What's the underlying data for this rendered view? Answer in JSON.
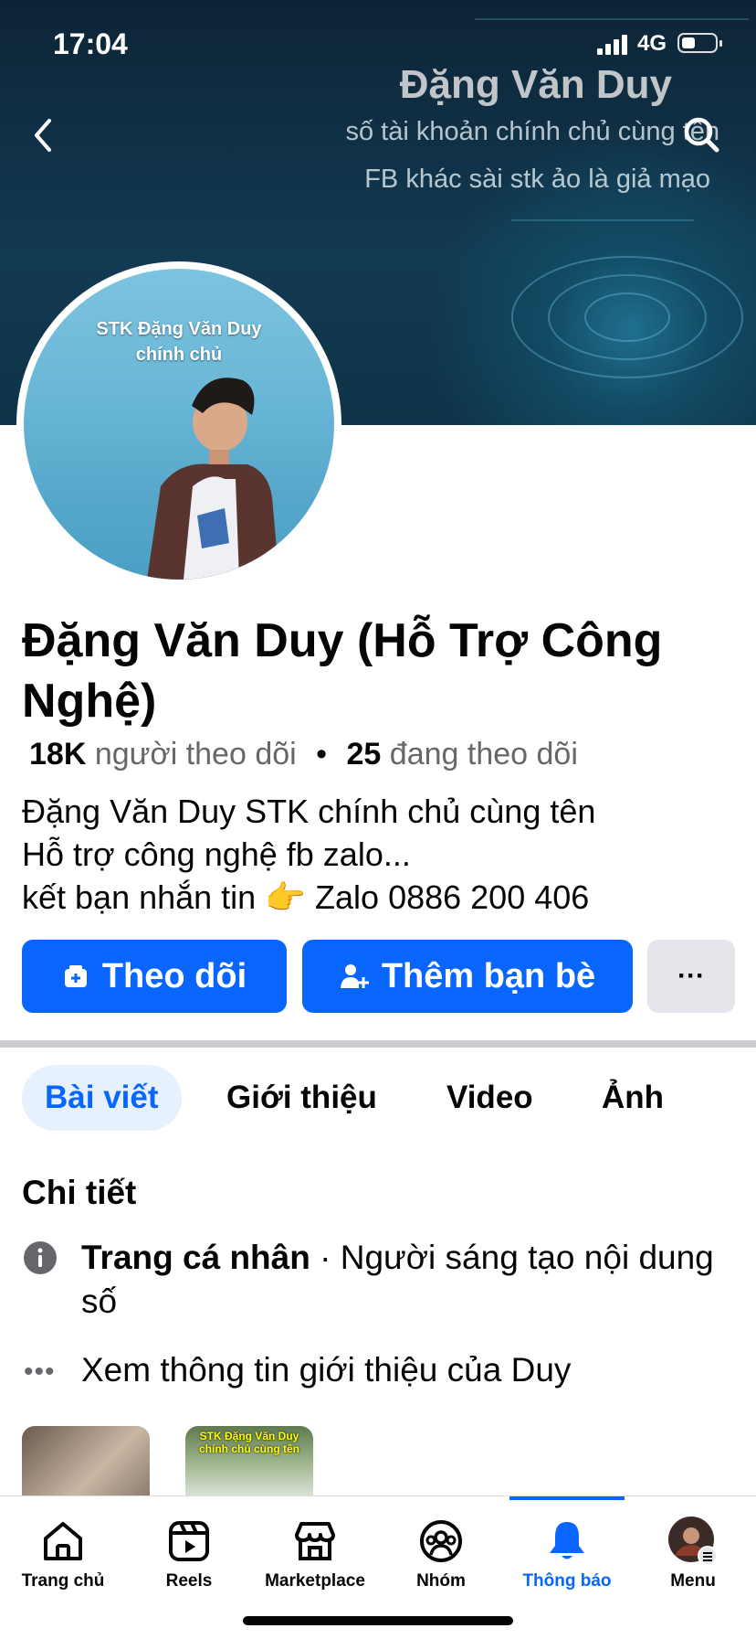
{
  "status_bar": {
    "time": "17:04",
    "network": "4G"
  },
  "cover": {
    "title": "Đặng Văn Duy",
    "line1": "số tài khoản chính chủ cùng tên",
    "line2": "FB khác sài stk ảo là giả mạo"
  },
  "avatar": {
    "caption_line1": "STK Đặng Văn Duy",
    "caption_line2": "chính chủ"
  },
  "profile": {
    "name": "Đặng Văn Duy (Hỗ Trợ Công Nghệ)",
    "followers_count": "18K",
    "followers_label": "người theo dõi",
    "separator": "•",
    "following_count": "25",
    "following_label": "đang theo dõi",
    "bio_line1": "Đặng Văn Duy STK chính chủ cùng tên",
    "bio_line2": "Hỗ trợ công nghệ fb zalo...",
    "bio_line3": "kết bạn nhắn tin 👉 Zalo 0886 200 406"
  },
  "actions": {
    "follow": "Theo dõi",
    "add_friend": "Thêm bạn bè",
    "more": "···"
  },
  "tabs": [
    {
      "label": "Bài viết",
      "active": true
    },
    {
      "label": "Giới thiệu"
    },
    {
      "label": "Video"
    },
    {
      "label": "Ảnh"
    }
  ],
  "details": {
    "title": "Chi tiết",
    "page_type": "Trang cá nhân",
    "page_category": " · Người sáng tạo nội dung số",
    "see_about": "Xem thông tin giới thiệu của Duy"
  },
  "thumbs": {
    "thumb2_caption": "STK Đặng Văn Duy chính chủ cùng tên"
  },
  "bottom_nav": [
    {
      "label": "Trang chủ",
      "icon": "home-icon"
    },
    {
      "label": "Reels",
      "icon": "reels-icon"
    },
    {
      "label": "Marketplace",
      "icon": "marketplace-icon"
    },
    {
      "label": "Nhóm",
      "icon": "groups-icon"
    },
    {
      "label": "Thông báo",
      "icon": "bell-icon",
      "active": true
    },
    {
      "label": "Menu",
      "icon": "menu-avatar-icon"
    }
  ],
  "colors": {
    "accent": "#0866ff",
    "secondary_button": "#e4e6eb",
    "muted_text": "#65676b"
  }
}
